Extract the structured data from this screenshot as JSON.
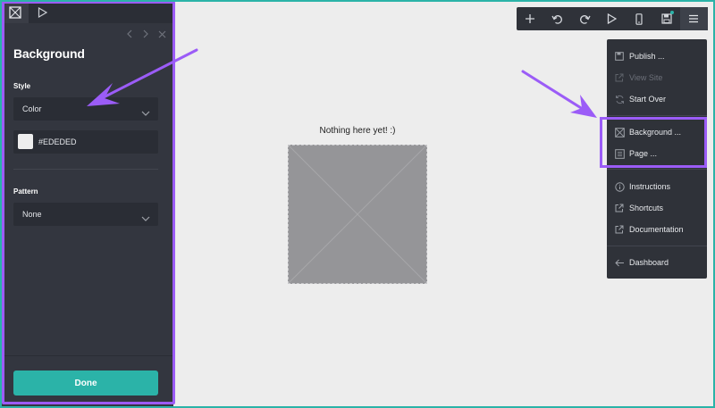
{
  "panel": {
    "title": "Background",
    "style_label": "Style",
    "style_value": "Color",
    "color_value": "#EDEDED",
    "pattern_label": "Pattern",
    "pattern_value": "None",
    "done_label": "Done"
  },
  "canvas": {
    "empty_message": "Nothing here yet! :)"
  },
  "toolbar": {
    "buttons": [
      "add-icon",
      "undo-icon",
      "redo-icon",
      "play-icon",
      "mobile-icon",
      "save-icon",
      "hamburger-menu-icon"
    ]
  },
  "menu": {
    "items": [
      {
        "label": "Publish ...",
        "icon": "save-icon",
        "enabled": true
      },
      {
        "label": "View Site",
        "icon": "external-link-icon",
        "enabled": false
      },
      {
        "label": "Start Over",
        "icon": "refresh-icon",
        "enabled": true
      },
      {
        "label": "Background ...",
        "icon": "background-icon",
        "enabled": true
      },
      {
        "label": "Page ...",
        "icon": "page-icon",
        "enabled": true
      },
      {
        "label": "Instructions",
        "icon": "info-icon",
        "enabled": true
      },
      {
        "label": "Shortcuts",
        "icon": "external-link-icon",
        "enabled": true
      },
      {
        "label": "Documentation",
        "icon": "external-link-icon",
        "enabled": true
      },
      {
        "label": "Dashboard",
        "icon": "arrow-left-icon",
        "enabled": true
      }
    ]
  },
  "colors": {
    "accent": "#2bb3a8",
    "panel_bg": "#33363f",
    "annotation": "#9b5cf7",
    "canvas_bg": "#ededed"
  }
}
